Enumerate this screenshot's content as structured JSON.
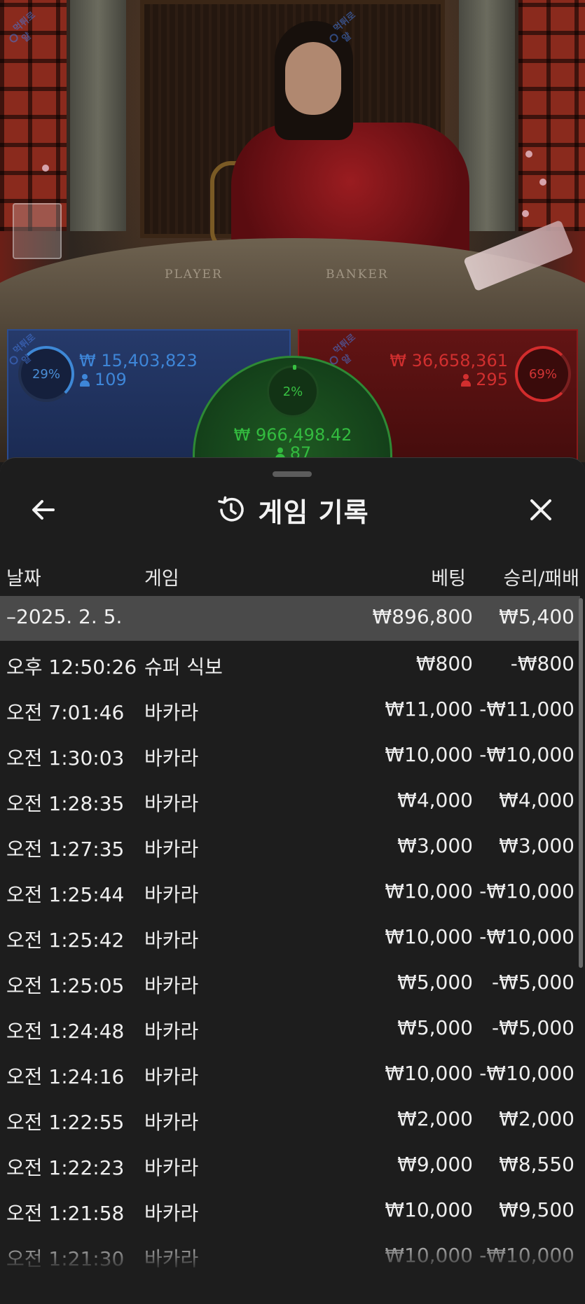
{
  "video": {
    "table_labels": {
      "player": "PLAYER",
      "banker": "BANKER"
    }
  },
  "betting": {
    "player": {
      "percent": "29%",
      "amount": "₩ 15,403,823",
      "count": "109",
      "color": "#3e86d8"
    },
    "tie": {
      "percent": "2%",
      "amount": "₩ 966,498.42",
      "count": "87",
      "color": "#33bb3f"
    },
    "banker": {
      "percent": "69%",
      "amount": "₩ 36,658,361",
      "count": "295",
      "color": "#d12f2f"
    }
  },
  "watermark": {
    "text": "먹튀로얄"
  },
  "sheet": {
    "title": "게임 기록",
    "icons": {
      "back": "arrow-left-icon",
      "history": "history-clock-icon",
      "close": "close-icon"
    },
    "columns": {
      "date": "날짜",
      "game": "게임",
      "bet": "베팅",
      "win_loss": "승리/패배"
    },
    "date_group": {
      "label": "–2025. 2. 5.",
      "bet": "₩896,800",
      "win_loss": "₩5,400"
    },
    "rows": [
      {
        "time": "오후 12:50:26",
        "game": "슈퍼 식보",
        "bet": "₩800",
        "win_loss": "-₩800"
      },
      {
        "time": "오전 7:01:46",
        "game": "바카라",
        "bet": "₩11,000",
        "win_loss": "-₩11,000"
      },
      {
        "time": "오전 1:30:03",
        "game": "바카라",
        "bet": "₩10,000",
        "win_loss": "-₩10,000"
      },
      {
        "time": "오전 1:28:35",
        "game": "바카라",
        "bet": "₩4,000",
        "win_loss": "₩4,000"
      },
      {
        "time": "오전 1:27:35",
        "game": "바카라",
        "bet": "₩3,000",
        "win_loss": "₩3,000"
      },
      {
        "time": "오전 1:25:44",
        "game": "바카라",
        "bet": "₩10,000",
        "win_loss": "-₩10,000"
      },
      {
        "time": "오전 1:25:42",
        "game": "바카라",
        "bet": "₩10,000",
        "win_loss": "-₩10,000"
      },
      {
        "time": "오전 1:25:05",
        "game": "바카라",
        "bet": "₩5,000",
        "win_loss": "-₩5,000"
      },
      {
        "time": "오전 1:24:48",
        "game": "바카라",
        "bet": "₩5,000",
        "win_loss": "-₩5,000"
      },
      {
        "time": "오전 1:24:16",
        "game": "바카라",
        "bet": "₩10,000",
        "win_loss": "-₩10,000"
      },
      {
        "time": "오전 1:22:55",
        "game": "바카라",
        "bet": "₩2,000",
        "win_loss": "₩2,000"
      },
      {
        "time": "오전 1:22:23",
        "game": "바카라",
        "bet": "₩9,000",
        "win_loss": "₩8,550"
      },
      {
        "time": "오전 1:21:58",
        "game": "바카라",
        "bet": "₩10,000",
        "win_loss": "₩9,500"
      },
      {
        "time": "오전 1:21:30",
        "game": "바카라",
        "bet": "₩10,000",
        "win_loss": "-₩10,000"
      }
    ]
  }
}
